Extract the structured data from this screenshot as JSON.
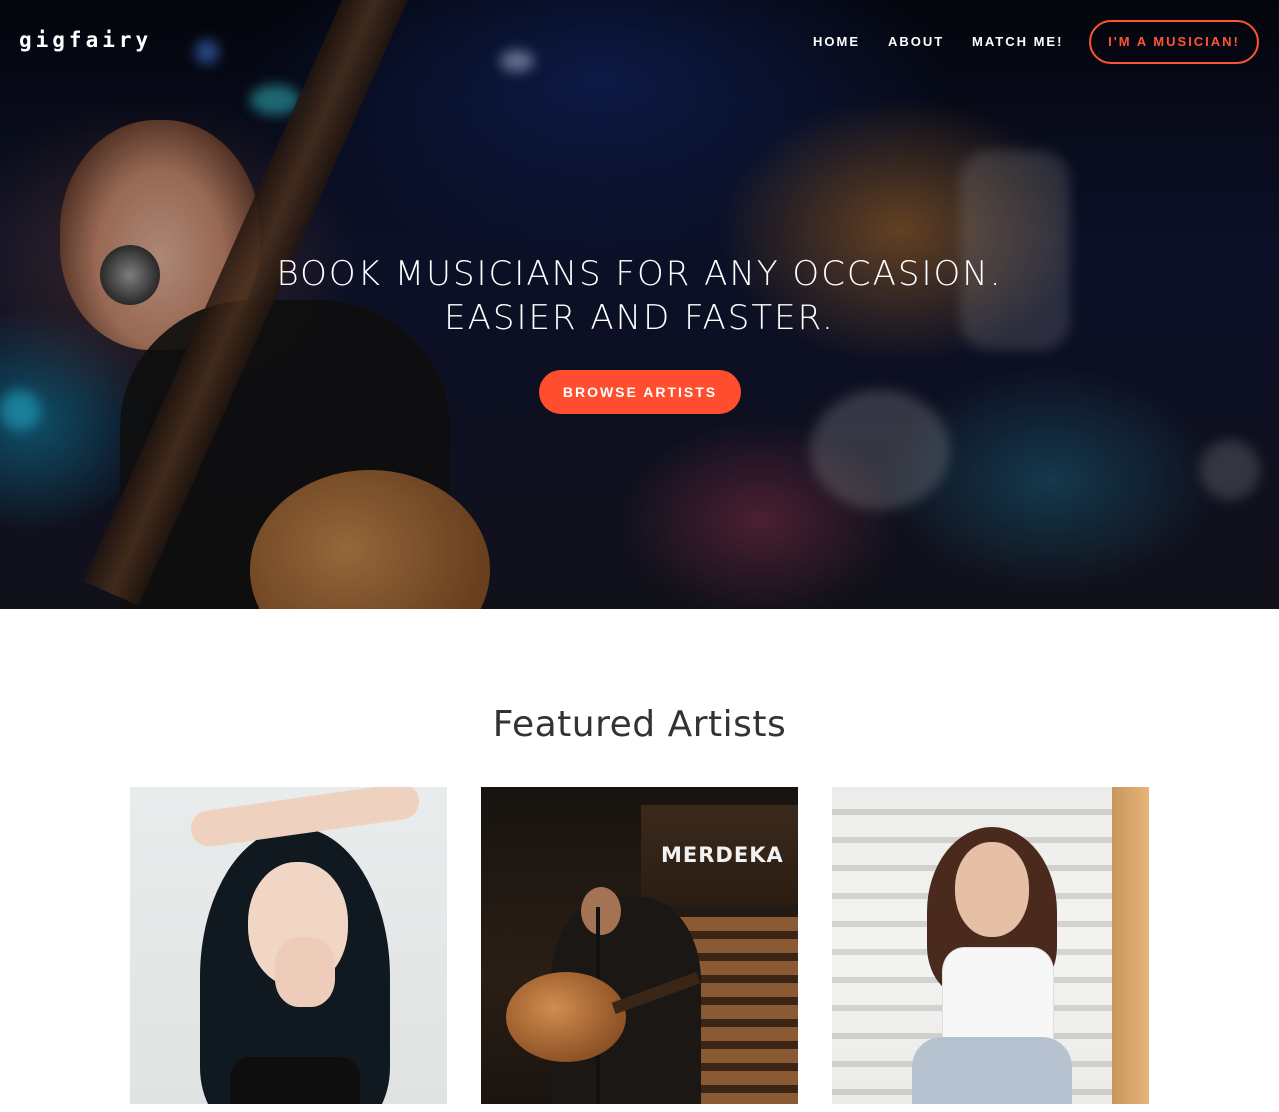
{
  "brand": {
    "logo": "gigfairy"
  },
  "nav": {
    "home": "HOME",
    "about": "ABOUT",
    "match": "MATCH ME!",
    "musician_cta": "I'M A MUSICIAN!"
  },
  "hero": {
    "headline_line1": "BOOK MUSICIANS FOR ANY OCCASION.",
    "headline_line2": "EASIER AND FASTER.",
    "cta": "BROWSE ARTISTS"
  },
  "featured": {
    "title": "Featured Artists",
    "artists": [
      {
        "photo": "artist-photo-1"
      },
      {
        "photo": "artist-photo-2",
        "venue_sign": "MERDEKA"
      },
      {
        "photo": "artist-photo-3"
      }
    ]
  },
  "colors": {
    "accent": "#ff4e2f",
    "text_dark": "#333333",
    "text_light": "#ffffff"
  }
}
